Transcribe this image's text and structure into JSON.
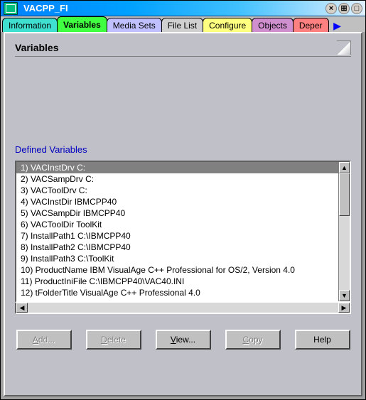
{
  "window": {
    "title": "VACPP_FI"
  },
  "title_buttons": {
    "close": "×",
    "grid": "⊞",
    "box": "□"
  },
  "tabs": [
    {
      "label": "Information",
      "bg": "#40e0d0"
    },
    {
      "label": "Variables",
      "bg": "#40ff40"
    },
    {
      "label": "Media Sets",
      "bg": "#c0c0ff"
    },
    {
      "label": "File List",
      "bg": "#d0d0d0"
    },
    {
      "label": "Configure",
      "bg": "#ffff80"
    },
    {
      "label": "Objects",
      "bg": "#d090d0"
    },
    {
      "label": "Deper",
      "bg": "#ff8080"
    }
  ],
  "active_tab_index": 1,
  "panel": {
    "title": "Variables",
    "section_label": "Defined Variables"
  },
  "variables": [
    {
      "n": 1,
      "name": "VACInstDrv",
      "value": "C:"
    },
    {
      "n": 2,
      "name": "VACSampDrv",
      "value": "C:"
    },
    {
      "n": 3,
      "name": "VACToolDrv",
      "value": "C:"
    },
    {
      "n": 4,
      "name": "VACInstDir",
      "value": "IBMCPP40"
    },
    {
      "n": 5,
      "name": "VACSampDir",
      "value": "IBMCPP40"
    },
    {
      "n": 6,
      "name": "VACToolDir",
      "value": "ToolKit"
    },
    {
      "n": 7,
      "name": "InstallPath1",
      "value": "C:\\IBMCPP40"
    },
    {
      "n": 8,
      "name": "InstallPath2",
      "value": "C:\\IBMCPP40"
    },
    {
      "n": 9,
      "name": "InstallPath3",
      "value": "C:\\ToolKit"
    },
    {
      "n": 10,
      "name": "ProductName",
      "value": "IBM VisualAge C++ Professional for OS/2, Version 4.0"
    },
    {
      "n": 11,
      "name": "ProductIniFile",
      "value": "C:\\IBMCPP40\\VAC40.INI"
    },
    {
      "n": 12,
      "name": "tFolderTitle",
      "value": "VisualAge C++ Professional 4.0"
    }
  ],
  "selected_index": 0,
  "buttons": {
    "add": {
      "label": "Add...",
      "enabled": false
    },
    "delete": {
      "label": "Delete",
      "enabled": false
    },
    "view": {
      "label": "View...",
      "enabled": true
    },
    "copy": {
      "label": "Copy",
      "enabled": false
    },
    "help": {
      "label": "Help",
      "enabled": true
    }
  }
}
